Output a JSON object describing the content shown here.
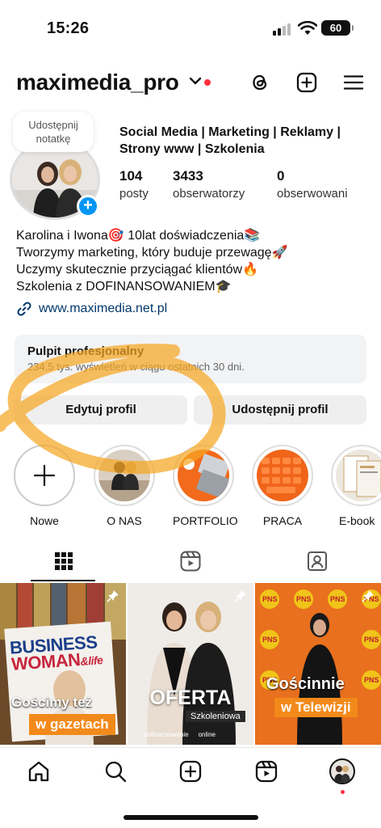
{
  "status_bar": {
    "time": "15:26",
    "battery": "60"
  },
  "header": {
    "username": "maximedia_pro"
  },
  "profile": {
    "note_bubble": [
      "Udostępnij",
      "notatkę"
    ],
    "category_lines": [
      "Social Media | Marketing | Reklamy |",
      "Strony www | Szkolenia"
    ],
    "stats": [
      {
        "number": "104",
        "label": "posty"
      },
      {
        "number": "3433",
        "label": "obserwatorzy"
      },
      {
        "number": "0",
        "label": "obserwowani"
      }
    ],
    "bio_lines": [
      "Karolina i Iwona🎯 10lat doświadczenia📚",
      "Tworzymy marketing, który buduje przewagę🚀",
      "Uczymy skutecznie przyciągać klientów🔥",
      "Szkolenia z DOFINANSOWANIEM🎓"
    ],
    "link": "www.maximedia.net.pl"
  },
  "dashboard": {
    "title": "Pulpit profesjonalny",
    "subtitle": "234,5 tys. wyświetleń w ciągu ostatnich 30 dni."
  },
  "buttons": {
    "edit": "Edytuj profil",
    "share": "Udostępnij profil"
  },
  "highlights": [
    {
      "label": "Nowe"
    },
    {
      "label": "O NAS"
    },
    {
      "label": "PORTFOLIO"
    },
    {
      "label": "PRACA"
    },
    {
      "label": "E-book"
    }
  ],
  "posts": [
    {
      "magazine_top": "BUSINESS",
      "magazine_bottom": "WOMAN",
      "magazine_amp": "&life",
      "line1": "Gościmy też",
      "line2": "w gazetach"
    },
    {
      "title": "OFERTA",
      "subtitle": "Szkoleniowa",
      "tag1": "dofinansowanie",
      "tag2": "online"
    },
    {
      "line1": "Gościnnie",
      "line2": "w Telewizji"
    }
  ],
  "colors": {
    "accent_blue": "#0095f6",
    "notification_red": "#ff3040",
    "highlight_orange": "#f5a623"
  },
  "icons": [
    "threads-icon",
    "add-post-icon",
    "menu-icon",
    "link-icon",
    "grid-icon",
    "reels-icon",
    "tagged-icon",
    "home-icon",
    "search-icon",
    "create-icon",
    "reels-nav-icon",
    "profile-avatar-icon"
  ]
}
